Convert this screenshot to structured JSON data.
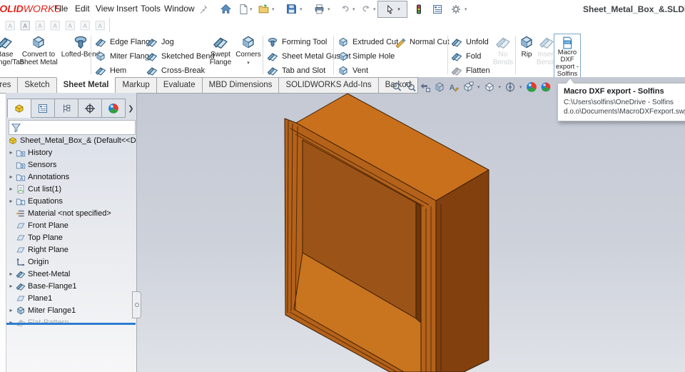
{
  "brand": {
    "solid": "SOLID",
    "works": "WORKS"
  },
  "window": {
    "title": "Sheet_Metal_Box_&.SLDPRT"
  },
  "menubar": {
    "items": [
      "File",
      "Edit",
      "View",
      "Insert",
      "Tools",
      "Window"
    ]
  },
  "icons": {
    "caret": "▾",
    "expand": "▸",
    "overflow": "❯",
    "quick_access": [
      "home-icon",
      "new-document-icon",
      "open-icon",
      "save-icon",
      "print-icon",
      "undo-icon",
      "redo-icon",
      "select-cursor-icon",
      "rebuild-traffic-light-icon",
      "options-list-icon",
      "settings-gear-icon"
    ],
    "headsup": [
      "zoom-to-fit-icon",
      "zoom-to-area-icon",
      "previous-view-icon",
      "section-view-icon",
      "annotation-visibility-icon",
      "view-orientation-icon",
      "display-style-icon",
      "hide-show-items-icon",
      "edit-appearance-icon",
      "apply-scene-icon"
    ]
  },
  "ribbon": {
    "base_flange": "Base Flange/Tab",
    "convert": "Convert to Sheet Metal",
    "lofted": "Lofted-Bend",
    "edge_flange": "Edge Flange",
    "miter_flange": "Miter Flange",
    "hem": "Hem",
    "jog": "Jog",
    "sketched_bend": "Sketched Bend",
    "cross_break": "Cross-Break",
    "swept_flange": "Swept Flange",
    "corners": "Corners",
    "forming_tool": "Forming Tool",
    "gusset": "Sheet Metal Gusset",
    "tab_slot": "Tab and Slot",
    "extruded_cut": "Extruded Cut",
    "simple_hole": "Simple Hole",
    "vent": "Vent",
    "normal_cut": "Normal Cut",
    "unfold": "Unfold",
    "fold": "Fold",
    "flatten": "Flatten",
    "no_bends": "No Bends",
    "rip": "Rip",
    "insert_bends": "Insert Bends",
    "macro": "Macro DXF export - Solfins"
  },
  "tabs": {
    "items": [
      "Features",
      "Sketch",
      "Sheet Metal",
      "Markup",
      "Evaluate",
      "MBD Dimensions",
      "SOLIDWORKS Add-Ins",
      "Barkod"
    ],
    "active": "Sheet Metal"
  },
  "tree": {
    "items": [
      {
        "label": "Sheet_Metal_Box_& (Default<<Default>",
        "type": "root"
      },
      {
        "label": "History",
        "expandable": true
      },
      {
        "label": "Sensors"
      },
      {
        "label": "Annotations",
        "expandable": true
      },
      {
        "label": "Cut list(1)",
        "expandable": true
      },
      {
        "label": "Equations",
        "expandable": true
      },
      {
        "label": "Material <not specified>"
      },
      {
        "label": "Front Plane"
      },
      {
        "label": "Top Plane"
      },
      {
        "label": "Right Plane"
      },
      {
        "label": "Origin"
      },
      {
        "label": "Sheet-Metal",
        "expandable": true
      },
      {
        "label": "Base-Flange1",
        "expandable": true
      },
      {
        "label": "Plane1"
      },
      {
        "label": "Miter Flange1",
        "expandable": true
      },
      {
        "label": "Flat-Pattern",
        "expandable": true,
        "suppressed": true
      }
    ]
  },
  "tooltip": {
    "title": "Macro DXF export - Solfins",
    "line1": "C:\\Users\\solfins\\OneDrive - Solfins",
    "line2": "d.o.o\\Documents\\MacroDXFexport.swp"
  },
  "colors": {
    "accent_blue": "#2e7dd1",
    "brand_red": "#e1251b",
    "part_top": "#c9701d",
    "part_front": "#b4621a",
    "part_right": "#81400d",
    "part_back_wall": "#9c5317",
    "part_floor": "#c9741f",
    "viewport_top": "#c3c8d3",
    "viewport_bottom": "#dfe2e7"
  }
}
